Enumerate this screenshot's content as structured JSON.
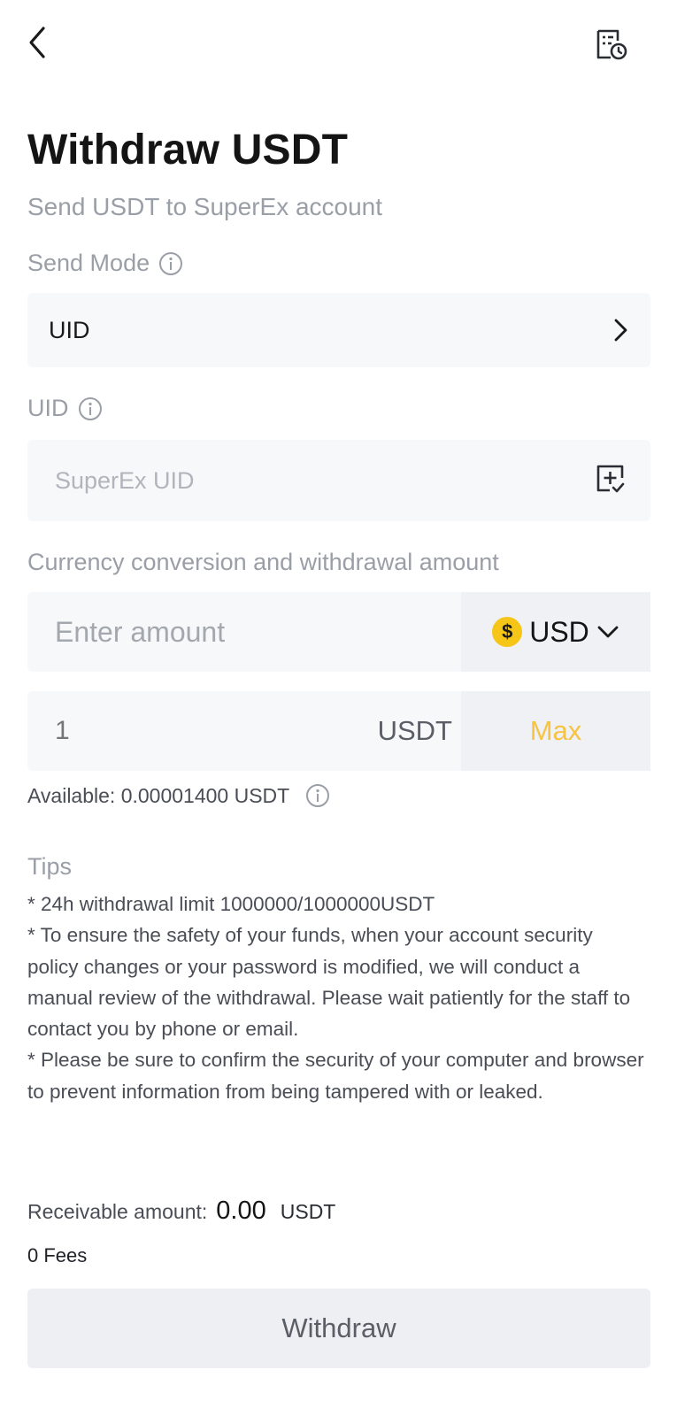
{
  "header": {
    "back_icon": "chevron-left-icon",
    "history_icon": "record-history-icon"
  },
  "page": {
    "title": "Withdraw USDT",
    "subtitle": "Send USDT to SuperEx account"
  },
  "send_mode": {
    "label": "Send Mode",
    "value": "UID"
  },
  "uid": {
    "label": "UID",
    "placeholder": "SuperEx UID",
    "value": ""
  },
  "amount": {
    "label": "Currency conversion and withdrawal amount",
    "placeholder": "Enter amount",
    "value": "",
    "currency": "USD",
    "currency_symbol": "$",
    "coin_color": "#f5c518"
  },
  "usdt_amount": {
    "placeholder": "1",
    "value": "",
    "unit": "USDT",
    "max_label": "Max",
    "max_color": "#f6c343"
  },
  "available": {
    "text": "Available: 0.00001400 USDT"
  },
  "tips": {
    "title": "Tips",
    "items": [
      "* 24h withdrawal limit 1000000/1000000USDT",
      "* To ensure the safety of your funds, when your account security policy changes or your password is modified, we will conduct a manual review of the withdrawal. Please wait patiently for the staff to contact you by phone or email.",
      "* Please be sure to confirm the security of your computer and browser to prevent information from being tampered with or leaked."
    ]
  },
  "receivable": {
    "label": "Receivable amount:",
    "value": "0.00",
    "unit": "USDT"
  },
  "fees": {
    "text": "0 Fees"
  },
  "submit": {
    "label": "Withdraw"
  }
}
